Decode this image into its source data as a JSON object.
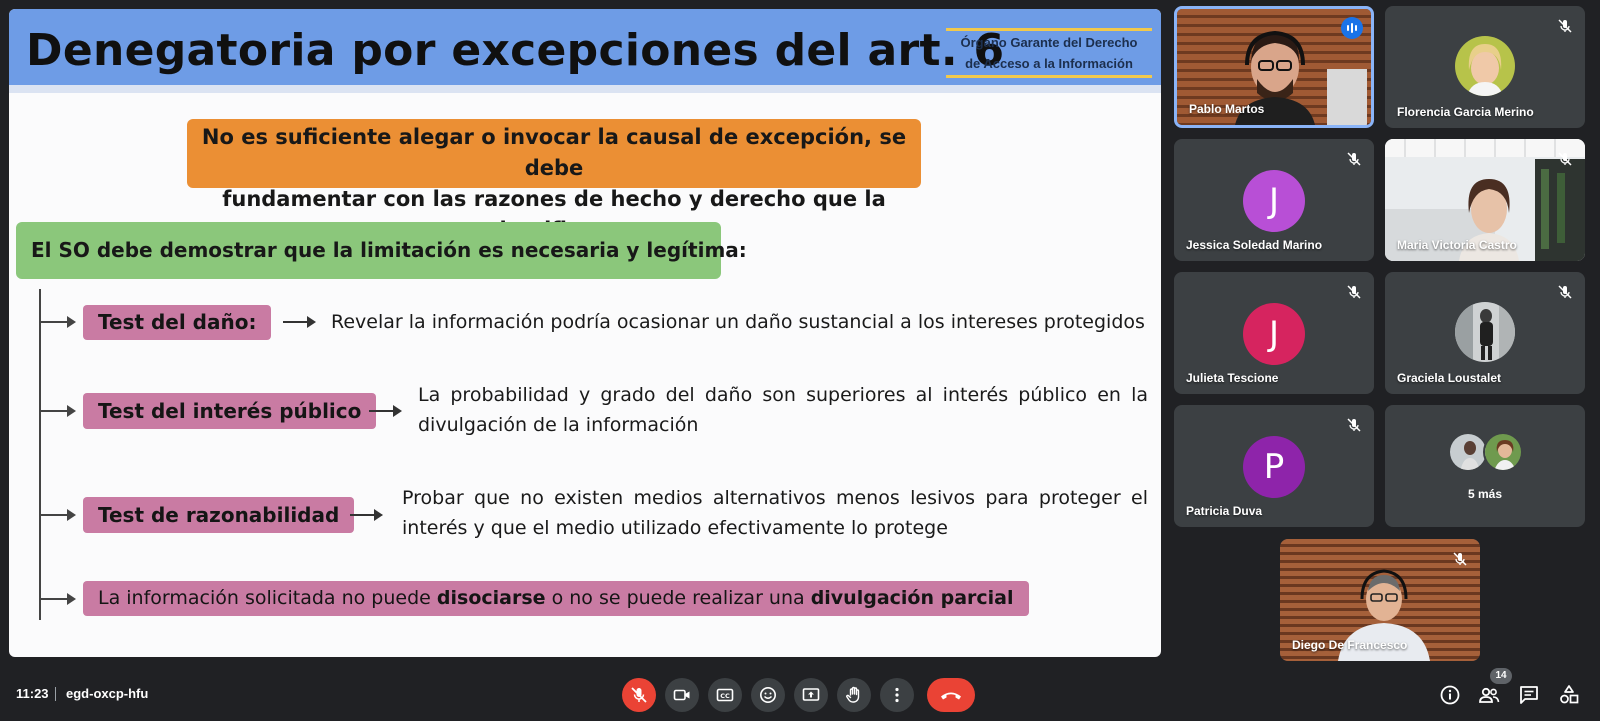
{
  "slide": {
    "title": "Denegatoria por excepciones del art. 6",
    "org_line1": "Órgano Garante del Derecho",
    "org_line2": "de Acceso a la Información",
    "callout_orange_line1": "No es suficiente alegar o invocar la causal de excepción, se debe",
    "callout_orange_line2": "fundamentar con las razones de hecho y derecho que la justifican",
    "callout_green": "El SO debe demostrar que la limitación es necesaria y legítima:",
    "tests": [
      {
        "label": "Test del daño:",
        "desc": "Revelar la información podría ocasionar un daño sustancial a los intereses protegidos"
      },
      {
        "label": "Test del interés público",
        "desc": "La probabilidad y grado del daño son superiores al interés público en la divulgación de la información"
      },
      {
        "label": "Test de razonabilidad",
        "desc": "Probar que no existen medios alternativos menos lesivos para proteger el interés y que el medio utilizado efectivamente lo protege"
      }
    ],
    "final": {
      "part1": "La información solicitada no puede ",
      "bold1": "disociarse",
      "part2": " o no se puede realizar una ",
      "bold2": "divulgación parcial"
    }
  },
  "participants": [
    {
      "name": "Pablo Martos",
      "speaking": true
    },
    {
      "name": "Florencia Garcia Merino",
      "muted": true
    },
    {
      "name": "Jessica Soledad Marino",
      "initial": "J",
      "color": "#b84fd6",
      "muted": true
    },
    {
      "name": "Maria Victoria Castro",
      "muted": true
    },
    {
      "name": "Julieta Tescione",
      "initial": "J",
      "color": "#d6245f",
      "muted": true
    },
    {
      "name": "Graciela Loustalet",
      "muted": true
    },
    {
      "name": "Patricia Duva",
      "initial": "P",
      "color": "#8e24aa",
      "muted": true
    },
    {
      "more_label": "5 más"
    },
    {
      "name": "Diego De Francesco",
      "muted": true
    }
  ],
  "bottom_bar": {
    "time": "11:23",
    "meeting_code": "egd-oxcp-hfu",
    "participant_count": "14"
  },
  "controls": [
    "mic-off",
    "camera",
    "captions",
    "emoji",
    "present-screen",
    "raise-hand",
    "more-options",
    "leave-call"
  ],
  "right_controls": [
    "meeting-info",
    "people",
    "chat",
    "activities"
  ],
  "colors": {
    "slide_header": "#6e9ce6",
    "orange_callout": "#eb8f34",
    "green_callout": "#8bc77b",
    "pink_pill": "#c97ba3",
    "leave_red": "#ea4335",
    "meet_background": "#202124",
    "tile_background": "#3c4043"
  }
}
